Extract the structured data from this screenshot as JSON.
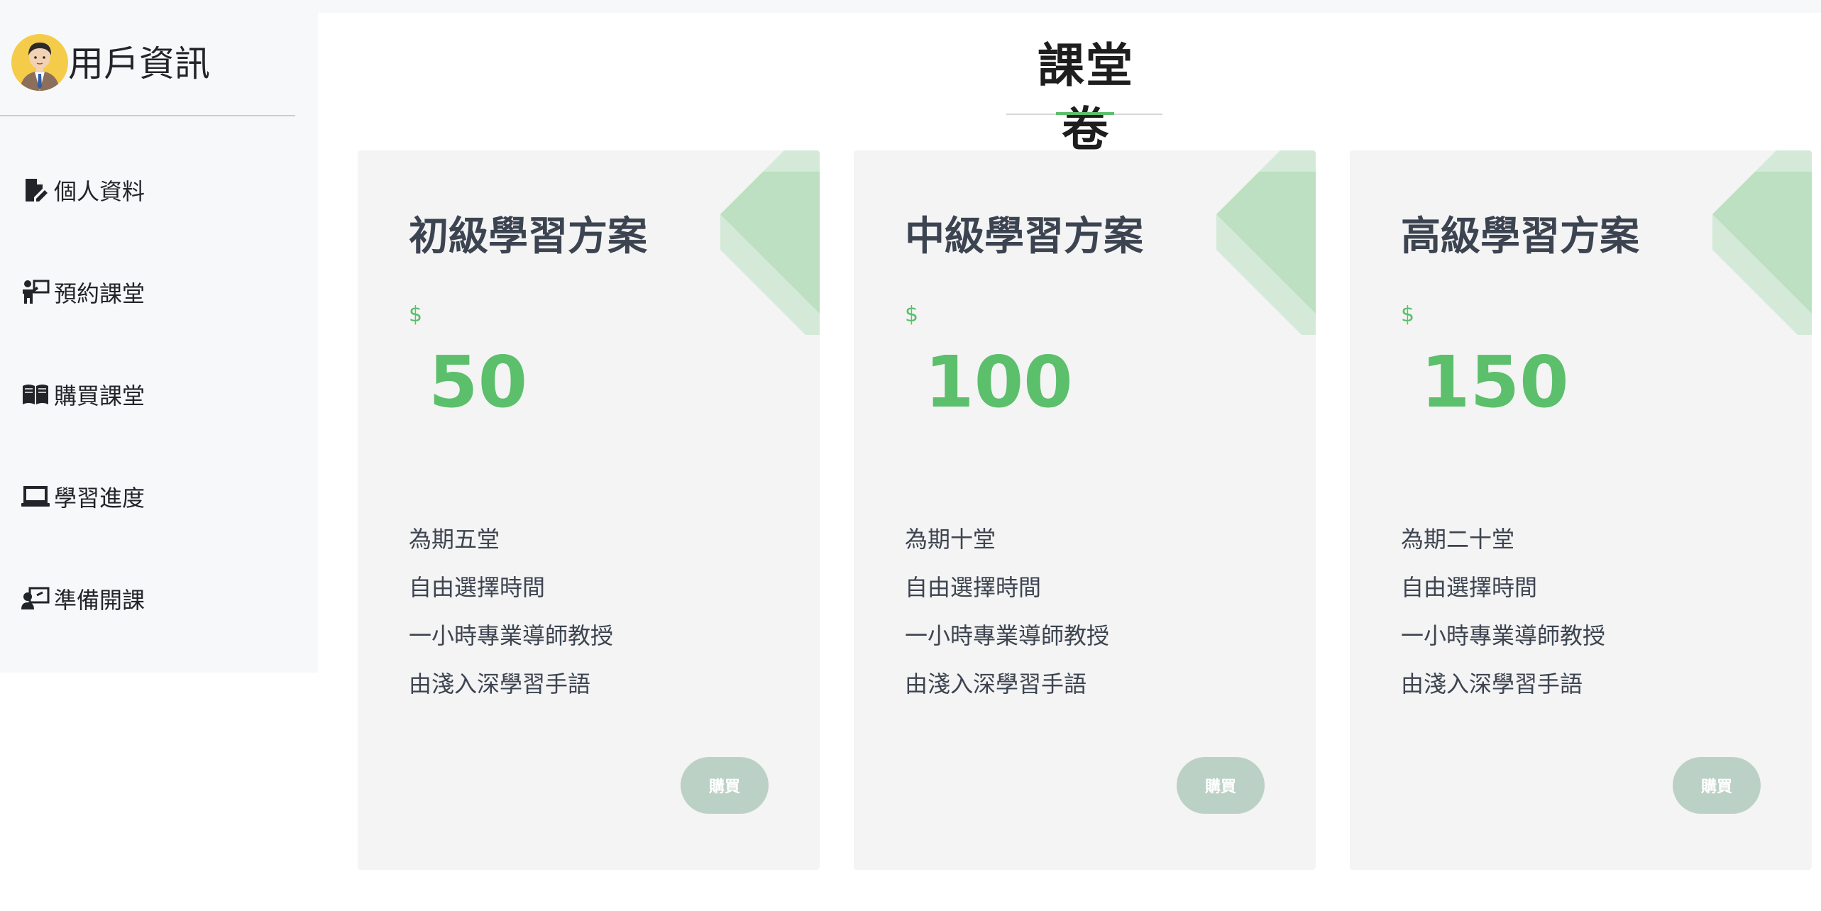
{
  "sidebar": {
    "user_title": "用戶資訊",
    "items": [
      {
        "label": "個人資料",
        "icon": "file-edit-icon"
      },
      {
        "label": "預約課堂",
        "icon": "teacher-board-icon"
      },
      {
        "label": "購買課堂",
        "icon": "open-book-icon"
      },
      {
        "label": "學習進度",
        "icon": "laptop-icon"
      },
      {
        "label": "準備開課",
        "icon": "presentation-icon"
      }
    ]
  },
  "main": {
    "title": "課堂卷"
  },
  "plans": [
    {
      "name": "初級學習方案",
      "currency": "$",
      "price": "50",
      "features": [
        "為期五堂",
        "自由選擇時間",
        "一小時專業導師教授",
        "由淺入深學習手語"
      ],
      "button": "購買"
    },
    {
      "name": "中級學習方案",
      "currency": "$",
      "price": "100",
      "features": [
        "為期十堂",
        "自由選擇時間",
        "一小時專業導師教授",
        "由淺入深學習手語"
      ],
      "button": "購買"
    },
    {
      "name": "高級學習方案",
      "currency": "$",
      "price": "150",
      "features": [
        "為期二十堂",
        "自由選擇時間",
        "一小時專業導師教授",
        "由淺入深學習手語"
      ],
      "button": "購買"
    }
  ],
  "colors": {
    "accent": "#5cbf6b",
    "button": "#bcd1c6",
    "card_bg": "#f4f4f4",
    "sidebar_bg": "#f7f8fa"
  }
}
